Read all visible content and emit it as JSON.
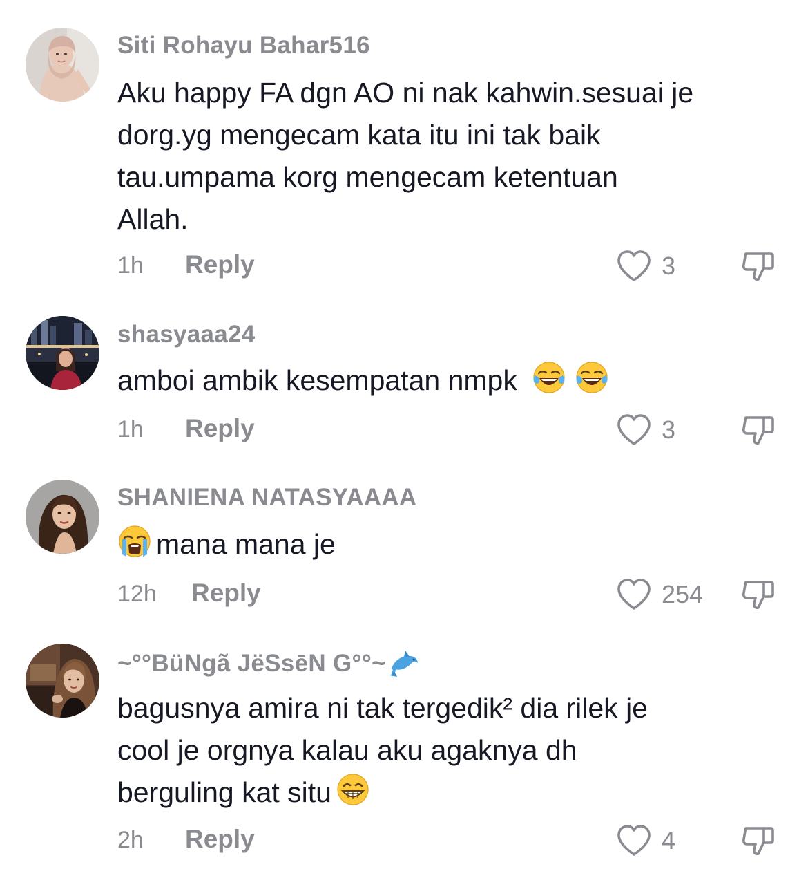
{
  "comments": [
    {
      "username": "Siti Rohayu Bahar516",
      "text_lines": [
        "Aku happy FA dgn AO ni nak kahwin.sesuai je",
        "dorg.yg mengecam kata itu ini tak baik",
        "tau.umpama korg mengecam ketentuan",
        "Allah."
      ],
      "time": "1h",
      "reply_label": "Reply",
      "likes": "3",
      "avatar_icon": "avatar-hijab-woman-icon"
    },
    {
      "username": "shasyaaa24",
      "text": "amboi ambik kesempatan nmpk",
      "emojis": [
        "face-with-tears-of-joy-icon",
        "face-with-tears-of-joy-icon"
      ],
      "time": "1h",
      "reply_label": "Reply",
      "likes": "3",
      "avatar_icon": "avatar-city-night-icon"
    },
    {
      "username": "SHANIENA NATASYAAAA",
      "text": "mana mana je",
      "emoji_leading": "loudly-crying-face-icon",
      "time": "12h",
      "reply_label": "Reply",
      "likes": "254",
      "avatar_icon": "avatar-woman-portrait-icon"
    },
    {
      "username": "~°°BüNgã JëSsēN G°°~",
      "username_emoji": "dolphin-icon",
      "text_lines": [
        "bagusnya amira ni tak tergedik² dia rilek je",
        "cool je orgnya kalau aku agaknya dh",
        "berguling kat situ"
      ],
      "emoji_trailing": "grinning-face-icon",
      "time": "2h",
      "reply_label": "Reply",
      "likes": "4",
      "avatar_icon": "avatar-woman-indoor-icon"
    }
  ],
  "colors": {
    "text": "#161823",
    "muted": "#8a8b91",
    "background": "#ffffff"
  }
}
